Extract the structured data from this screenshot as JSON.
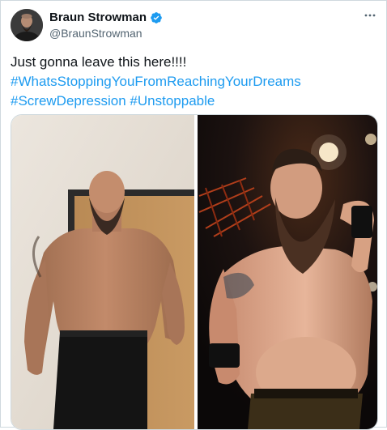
{
  "author": {
    "display_name": "Braun Strowman",
    "handle": "@BraunStrowman",
    "verified": true,
    "avatar_icon": "profile-photo"
  },
  "menu_icon": "more-options-icon",
  "tweet": {
    "text": "Just gonna leave this here!!!!",
    "hashtags": [
      "#WhatsStoppingYouFromReachingYourDreams",
      "#ScrewDepression",
      "#Unstoppable"
    ]
  },
  "media": {
    "left_photo": "before-photo-gym",
    "right_photo": "after-photo-ring"
  },
  "colors": {
    "link": "#1d9bf0",
    "verified": "#1d9bf0",
    "text": "#0f1419",
    "secondary": "#536471",
    "border": "#cfd9de"
  }
}
